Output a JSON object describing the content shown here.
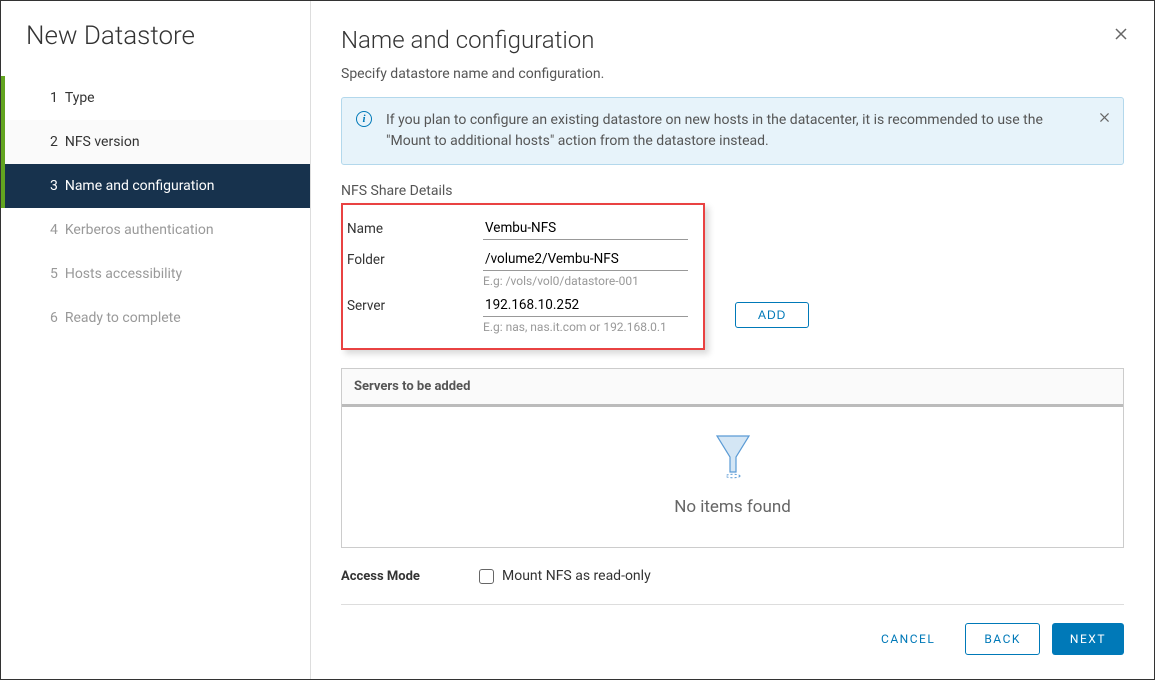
{
  "sidebar": {
    "title": "New Datastore",
    "steps": [
      {
        "num": "1",
        "label": "Type"
      },
      {
        "num": "2",
        "label": "NFS version"
      },
      {
        "num": "3",
        "label": "Name and configuration"
      },
      {
        "num": "4",
        "label": "Kerberos authentication"
      },
      {
        "num": "5",
        "label": "Hosts accessibility"
      },
      {
        "num": "6",
        "label": "Ready to complete"
      }
    ]
  },
  "main": {
    "title": "Name and configuration",
    "subtitle": "Specify datastore name and configuration.",
    "info_banner": "If you plan to configure an existing datastore on new hosts in the datacenter, it is recommended to use the \"Mount to additional hosts\" action from the datastore instead.",
    "nfs_section_title": "NFS Share Details",
    "fields": {
      "name_label": "Name",
      "name_value": "Vembu-NFS",
      "folder_label": "Folder",
      "folder_value": "/volume2/Vembu-NFS",
      "folder_hint": "E.g: /vols/vol0/datastore-001",
      "server_label": "Server",
      "server_value": "192.168.10.252",
      "server_hint": "E.g: nas, nas.it.com or 192.168.0.1"
    },
    "add_button": "ADD",
    "servers_panel": {
      "header": "Servers to be added",
      "empty": "No items found"
    },
    "access_mode": {
      "label": "Access Mode",
      "checkbox_label": "Mount NFS as read-only"
    }
  },
  "footer": {
    "cancel": "CANCEL",
    "back": "BACK",
    "next": "NEXT"
  }
}
